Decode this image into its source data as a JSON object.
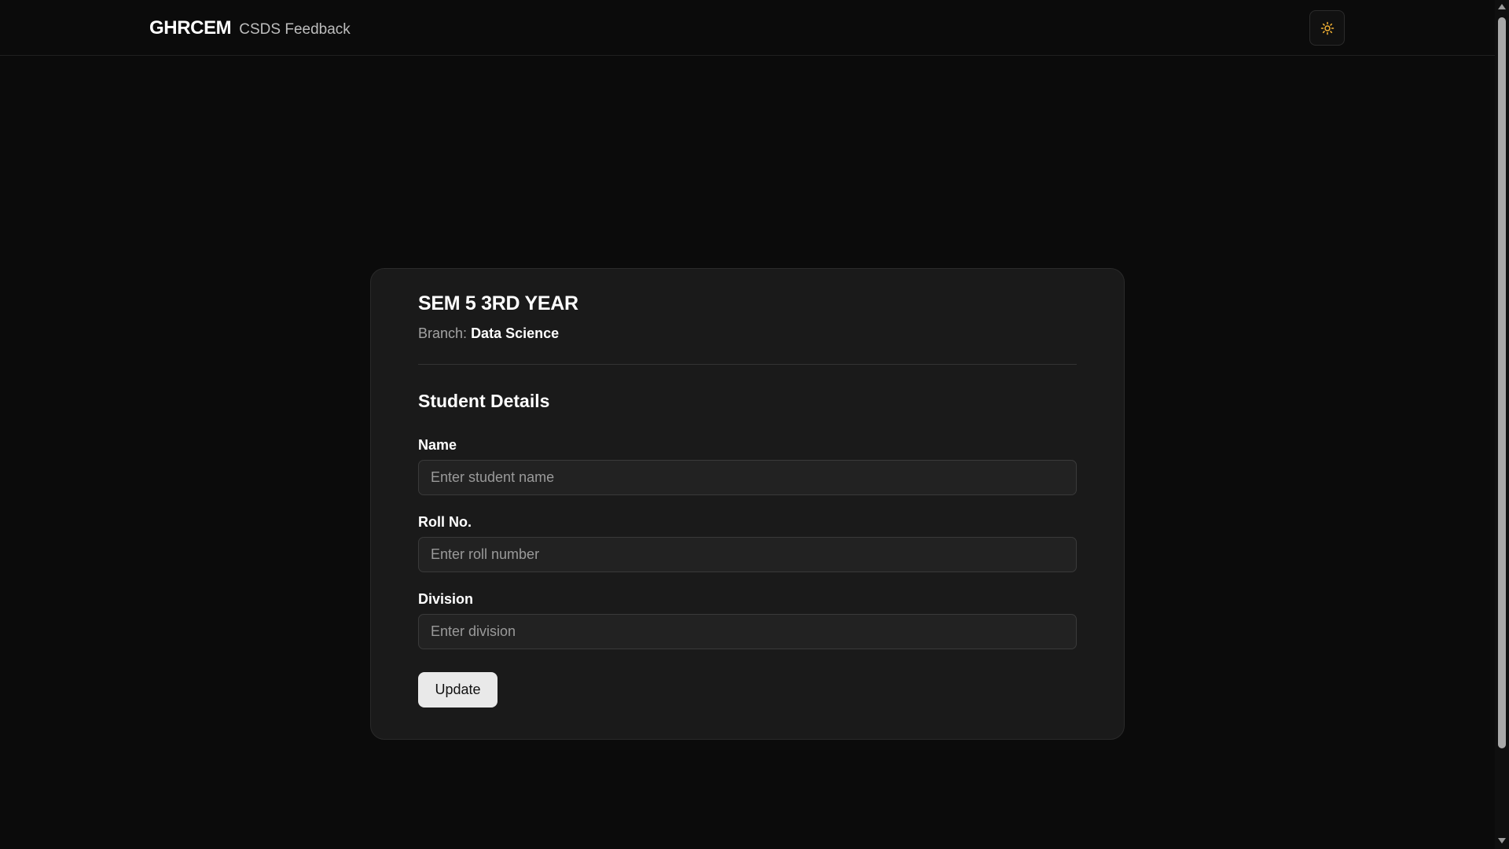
{
  "header": {
    "brand_name": "GHRCEM",
    "brand_subtitle": "CSDS Feedback",
    "theme_toggle_icon": "sun-icon",
    "theme_icon_color": "#f5b335"
  },
  "card": {
    "title": "SEM 5 3RD YEAR",
    "branch_label": "Branch:",
    "branch_value": "Data Science",
    "section_title": "Student Details",
    "fields": {
      "name": {
        "label": "Name",
        "placeholder": "Enter student name",
        "value": ""
      },
      "roll": {
        "label": "Roll No.",
        "placeholder": "Enter roll number",
        "value": ""
      },
      "division": {
        "label": "Division",
        "placeholder": "Enter division",
        "value": ""
      }
    },
    "submit_label": "Update"
  },
  "colors": {
    "background": "#0b0b0b",
    "card": "#1a1a1a",
    "input": "#222222",
    "button": "#e9e9e9"
  }
}
